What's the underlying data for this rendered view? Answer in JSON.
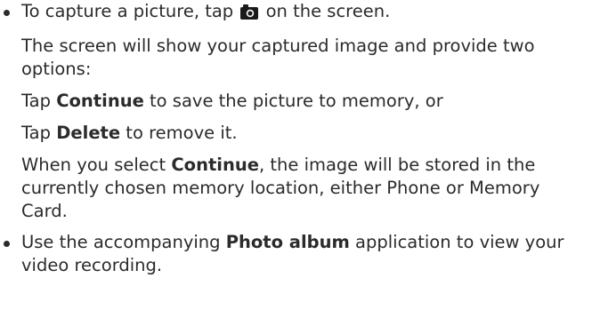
{
  "item1": {
    "step_before_icon": "To capture a picture, tap",
    "step_icon": "camera-icon",
    "step_after_icon": "on the screen.",
    "result_text": "The screen will show your captured image and provide two options:",
    "continue_prefix": "Tap",
    "continue_label": "Continue",
    "continue_suffix": "to save the picture to memory, or",
    "delete_prefix": "Tap",
    "delete_label": "Delete",
    "delete_suffix": "to remove it.",
    "select_prefix": "When you select",
    "select_label": "Continue",
    "select_suffix": ", the image will be stored in the currently chosen memory location, either Phone or Memory Card."
  },
  "item2": {
    "prefix": "Use the accompanying",
    "app_label": "Photo album",
    "suffix": "application to view your video recording."
  }
}
